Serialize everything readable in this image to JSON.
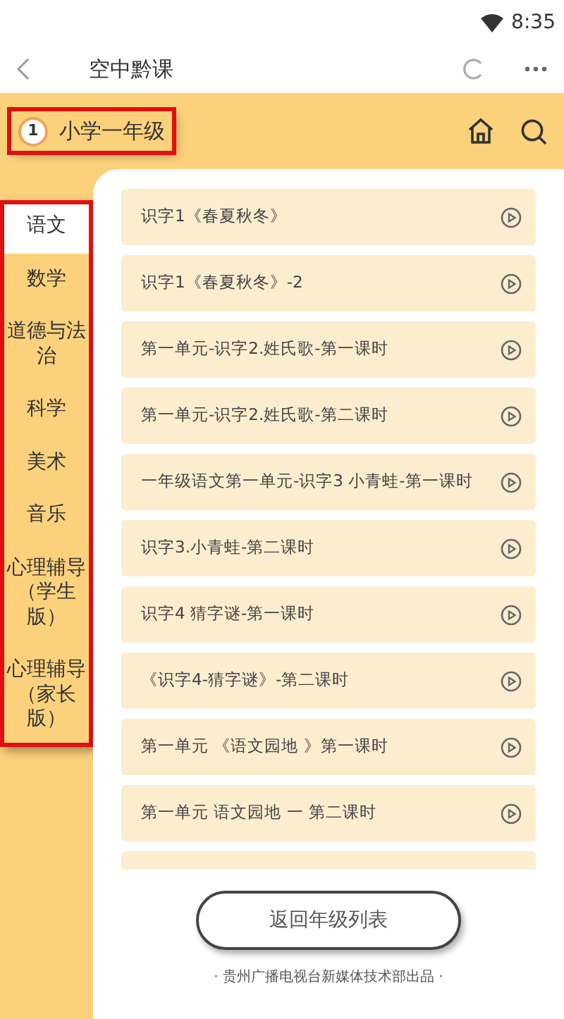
{
  "status_bar": {
    "time": "8:35"
  },
  "app_bar": {
    "title": "空中黔课"
  },
  "grade": {
    "badge": "1",
    "name": "小学一年级",
    "highlighted": true
  },
  "subjects": {
    "highlighted": true,
    "items": [
      {
        "label": "语文",
        "selected": true
      },
      {
        "label": "数学",
        "selected": false
      },
      {
        "label": "道德与法治",
        "selected": false
      },
      {
        "label": "科学",
        "selected": false
      },
      {
        "label": "美术",
        "selected": false
      },
      {
        "label": "音乐",
        "selected": false
      },
      {
        "label": "心理辅导（学生版）",
        "selected": false
      },
      {
        "label": "心理辅导（家长版）",
        "selected": false
      }
    ]
  },
  "lessons": [
    {
      "kind": "lesson",
      "title": "识字1《春夏秋冬》"
    },
    {
      "kind": "lesson",
      "title": "识字1《春夏秋冬》-2"
    },
    {
      "kind": "lesson",
      "title": "第一单元-识字2.姓氏歌-第一课时"
    },
    {
      "kind": "lesson",
      "title": "第一单元-识字2.姓氏歌-第二课时"
    },
    {
      "kind": "lesson",
      "title": "一年级语文第一单元-识字3 小青蛙-第一课时"
    },
    {
      "kind": "lesson",
      "title": "识字3.小青蛙-第二课时"
    },
    {
      "kind": "lesson",
      "title": "识字4 猜字谜-第一课时"
    },
    {
      "kind": "lesson",
      "title": "《识字4-猜字谜》-第二课时"
    },
    {
      "kind": "lesson",
      "title": "第一单元 《语文园地 》第一课时"
    },
    {
      "kind": "lesson",
      "title": "第一单元 语文园地 一 第二课时"
    },
    {
      "kind": "clipped"
    }
  ],
  "return_button": "返回年级列表",
  "footer": "· 贵州广播电视台新媒体技术部出品 ·"
}
